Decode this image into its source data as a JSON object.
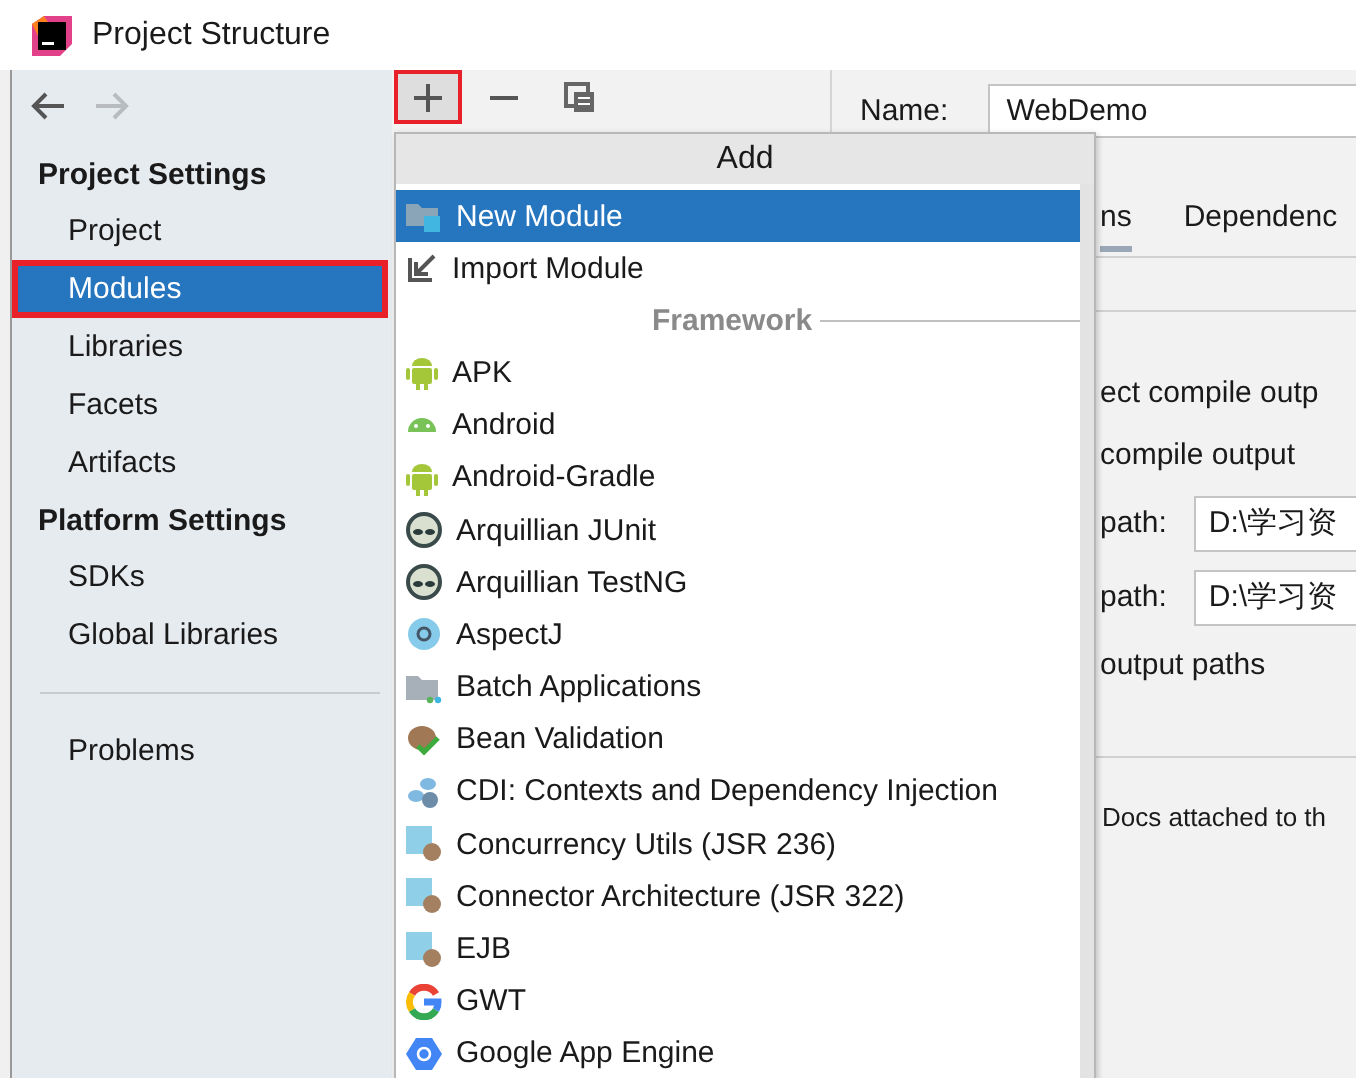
{
  "window": {
    "title": "Project Structure"
  },
  "navigation": [
    {
      "kind": "back",
      "disabled": false
    },
    {
      "kind": "forward",
      "disabled": true
    }
  ],
  "sidebar": {
    "sections": [
      {
        "header": "Project Settings",
        "items": [
          {
            "label": "Project",
            "selected": false,
            "highlighted": false
          },
          {
            "label": "Modules",
            "selected": true,
            "highlighted": true
          },
          {
            "label": "Libraries",
            "selected": false,
            "highlighted": false
          },
          {
            "label": "Facets",
            "selected": false,
            "highlighted": false
          },
          {
            "label": "Artifacts",
            "selected": false,
            "highlighted": false
          }
        ]
      },
      {
        "header": "Platform Settings",
        "items": [
          {
            "label": "SDKs",
            "selected": false,
            "highlighted": false
          },
          {
            "label": "Global Libraries",
            "selected": false,
            "highlighted": false
          }
        ]
      },
      {
        "items": [
          {
            "label": "Problems",
            "selected": false,
            "highlighted": false
          }
        ]
      }
    ]
  },
  "toolbar": [
    {
      "kind": "add",
      "highlighted": true
    },
    {
      "kind": "remove",
      "highlighted": false
    },
    {
      "kind": "copy",
      "highlighted": false
    }
  ],
  "add_popup": {
    "title": "Add",
    "items": [
      {
        "kind": "item",
        "label": "New Module",
        "selected": true
      },
      {
        "kind": "item",
        "label": "Import Module",
        "selected": false
      },
      {
        "kind": "separator",
        "label": "Framework"
      },
      {
        "kind": "item",
        "label": "APK",
        "selected": false
      },
      {
        "kind": "item",
        "label": "Android",
        "selected": false
      },
      {
        "kind": "item",
        "label": "Android-Gradle",
        "selected": false
      },
      {
        "kind": "item",
        "label": "Arquillian JUnit",
        "selected": false
      },
      {
        "kind": "item",
        "label": "Arquillian TestNG",
        "selected": false
      },
      {
        "kind": "item",
        "label": "AspectJ",
        "selected": false
      },
      {
        "kind": "item",
        "label": "Batch Applications",
        "selected": false
      },
      {
        "kind": "item",
        "label": "Bean Validation",
        "selected": false
      },
      {
        "kind": "item",
        "label": "CDI: Contexts and Dependency Injection",
        "selected": false
      },
      {
        "kind": "item",
        "label": "Concurrency Utils (JSR 236)",
        "selected": false
      },
      {
        "kind": "item",
        "label": "Connector Architecture (JSR 322)",
        "selected": false
      },
      {
        "kind": "item",
        "label": "EJB",
        "selected": false
      },
      {
        "kind": "item",
        "label": "GWT",
        "selected": false
      },
      {
        "kind": "item",
        "label": "Google App Engine",
        "selected": false
      }
    ]
  },
  "module": {
    "name_label": "Name:",
    "name": "WebDemo",
    "tabs": [
      {
        "label": "ns",
        "selected": true
      },
      {
        "label": "Dependenc",
        "selected": false
      }
    ],
    "lines": [
      {
        "kind": "text",
        "text": "ect compile outp"
      },
      {
        "kind": "text",
        "text": "compile output"
      },
      {
        "kind": "path",
        "label": "path:",
        "value": "D:\\学习资"
      },
      {
        "kind": "path",
        "label": "path:",
        "value": "D:\\学习资"
      },
      {
        "kind": "text",
        "text": "output paths"
      },
      {
        "kind": "note",
        "text": "Docs attached to th"
      }
    ]
  }
}
